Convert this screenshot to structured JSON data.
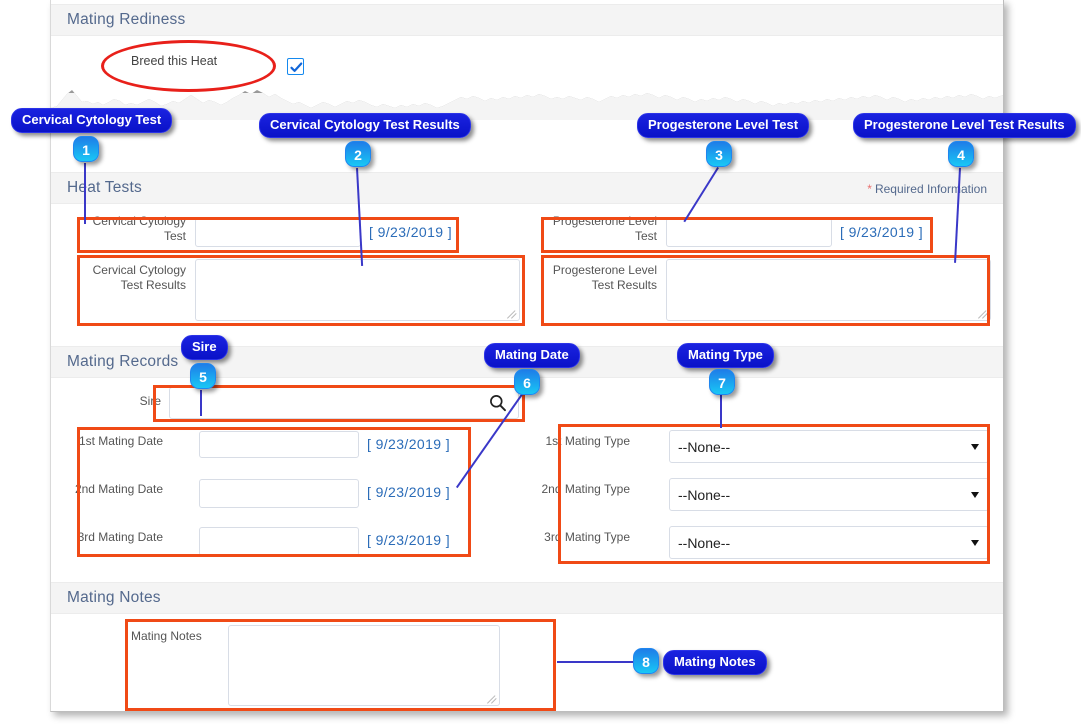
{
  "sections": {
    "mating_readiness": {
      "title": "Mating Rediness",
      "breed_this_heat_label": "Breed this Heat",
      "breed_this_heat_checked": true
    },
    "heat_tests": {
      "title": "Heat Tests",
      "required_star": "*",
      "required_text": "Required Information",
      "fields": {
        "cervical_cytology_test": {
          "label": "Cervical Cytology\nTest",
          "value": "",
          "date_hint": "[ 9/23/2019 ]"
        },
        "cervical_cytology_test_results": {
          "label": "Cervical Cytology\nTest Results",
          "value": ""
        },
        "progesterone_level_test": {
          "label": "Progesterone Level\nTest",
          "value": "",
          "date_hint": "[ 9/23/2019 ]"
        },
        "progesterone_level_test_results": {
          "label": "Progesterone Level\nTest Results",
          "value": ""
        }
      }
    },
    "mating_records": {
      "title": "Mating Records",
      "sire": {
        "label": "Sire",
        "value": "",
        "icon": "search-icon"
      },
      "mating_dates": [
        {
          "label": "1st Mating Date",
          "value": "",
          "date_hint": "[ 9/23/2019 ]"
        },
        {
          "label": "2nd Mating Date",
          "value": "",
          "date_hint": "[ 9/23/2019 ]"
        },
        {
          "label": "3rd Mating Date",
          "value": "",
          "date_hint": "[ 9/23/2019 ]"
        }
      ],
      "mating_types": [
        {
          "label": "1st Mating Type",
          "value": "--None--"
        },
        {
          "label": "2nd Mating Type",
          "value": "--None--"
        },
        {
          "label": "3rd Mating Type",
          "value": "--None--"
        }
      ]
    },
    "mating_notes": {
      "title": "Mating Notes",
      "field_label": "Mating Notes",
      "value": ""
    }
  },
  "callouts": [
    {
      "num": "1",
      "label": "Cervical Cytology Test"
    },
    {
      "num": "2",
      "label": "Cervical Cytology Test Results"
    },
    {
      "num": "3",
      "label": "Progesterone Level Test"
    },
    {
      "num": "4",
      "label": "Progesterone Level Test Results"
    },
    {
      "num": "5",
      "label": "Sire"
    },
    {
      "num": "6",
      "label": "Mating Date"
    },
    {
      "num": "7",
      "label": "Mating Type"
    },
    {
      "num": "8",
      "label": "Mating Notes"
    }
  ],
  "colors": {
    "highlight_box": "#f04a16",
    "ellipse": "#e8201a",
    "callout_label_bg": "#0a12c8",
    "callout_num_bg": "#19c8f5",
    "section_title": "#54698d",
    "date_hint": "#2b6cb8",
    "required_star": "#e8706f",
    "checkbox_accent": "#1589ee"
  }
}
